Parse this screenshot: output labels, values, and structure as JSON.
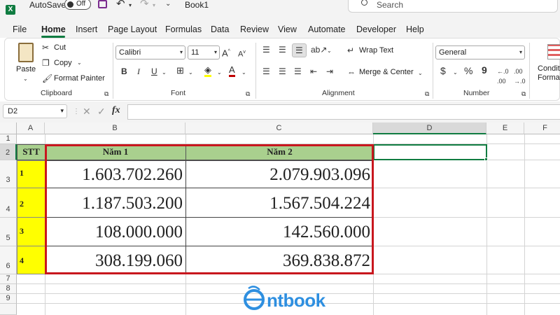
{
  "titlebar": {
    "autosave_label": "AutoSave",
    "autosave_state": "Off",
    "book_title": "Book1",
    "search_placeholder": "Search"
  },
  "menu": [
    "File",
    "Home",
    "Insert",
    "Page Layout",
    "Formulas",
    "Data",
    "Review",
    "View",
    "Automate",
    "Developer",
    "Help"
  ],
  "ribbon": {
    "paste": "Paste",
    "cut": "Cut",
    "copy": "Copy",
    "format_painter": "Format Painter",
    "clipboard": "Clipboard",
    "font_name": "Calibri",
    "font_size": "11",
    "font": "Font",
    "wrap_text": "Wrap Text",
    "merge_center": "Merge & Center",
    "alignment": "Alignment",
    "number_format": "General",
    "number": "Number",
    "conditional_1": "Conditi",
    "conditional_2": "Format"
  },
  "formula": {
    "name_box": "D2",
    "fx": "fx",
    "content": ""
  },
  "columns": [
    "A",
    "B",
    "C",
    "D",
    "E",
    "F"
  ],
  "rows": [
    "1",
    "2",
    "3",
    "4",
    "5",
    "6",
    "7",
    "8",
    "9"
  ],
  "table": {
    "headers": [
      "STT",
      "Năm 1",
      "Năm 2"
    ],
    "rows": [
      {
        "stt": "1",
        "n1": "1.603.702.260",
        "n2": "2.079.903.096"
      },
      {
        "stt": "2",
        "n1": "1.187.503.200",
        "n2": "1.567.504.224"
      },
      {
        "stt": "3",
        "n1": "108.000.000",
        "n2": "142.560.000"
      },
      {
        "stt": "4",
        "n1": "308.199.060",
        "n2": "369.838.872"
      }
    ]
  },
  "watermark": "ntbook",
  "colors": {
    "header_fill": "#a9d08e",
    "stt_fill": "#ffff00",
    "highlight_border": "#c8171e",
    "excel_green": "#107c41",
    "logo_blue": "#2e8fe0"
  }
}
